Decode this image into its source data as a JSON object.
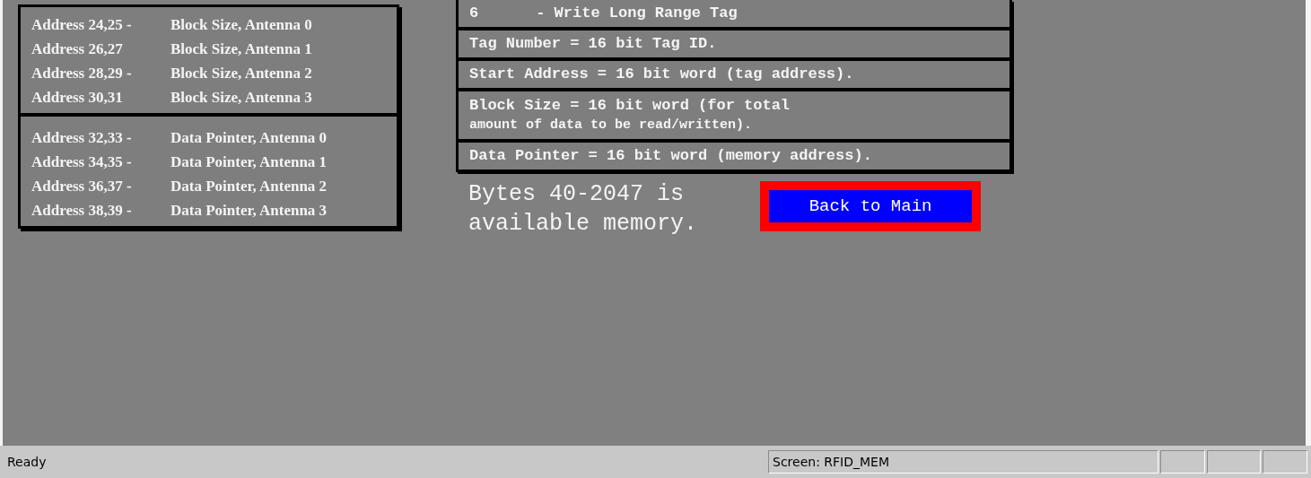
{
  "address_panel": {
    "sections": [
      [
        {
          "address": "Address 24,25 -",
          "description": "Block Size, Antenna 0"
        },
        {
          "address": "Address 26,27",
          "description": "Block Size, Antenna 1"
        },
        {
          "address": "Address 28,29 -",
          "description": "Block Size, Antenna 2"
        },
        {
          "address": "Address 30,31",
          "description": "Block Size, Antenna 3"
        }
      ],
      [
        {
          "address": "Address 32,33 -",
          "description": "Data Pointer, Antenna 0"
        },
        {
          "address": "Address 34,35 -",
          "description": "Data Pointer, Antenna 1"
        },
        {
          "address": "Address 36,37 -",
          "description": "Data Pointer, Antenna 2"
        },
        {
          "address": "Address 38,39 -",
          "description": "Data Pointer, Antenna 3"
        }
      ]
    ]
  },
  "definitions_panel": {
    "rows": [
      {
        "kind": "command",
        "code": "6",
        "text": "- Write Long Range Tag"
      },
      {
        "kind": "line",
        "lines": [
          "Tag Number = 16 bit Tag ID."
        ]
      },
      {
        "kind": "line",
        "lines": [
          "Start Address = 16 bit word (tag address)."
        ]
      },
      {
        "kind": "line",
        "lines": [
          "Block Size = 16 bit word (for total",
          "amount of data to be read/written)."
        ]
      },
      {
        "kind": "line",
        "lines": [
          "Data Pointer = 16 bit word (memory address)."
        ]
      }
    ]
  },
  "memory_note": [
    "Bytes 40-2047 is",
    "available memory."
  ],
  "back_button": {
    "label": "Back to Main"
  },
  "status_bar": {
    "message": "Ready",
    "screen": "Screen: RFID_MEM"
  }
}
